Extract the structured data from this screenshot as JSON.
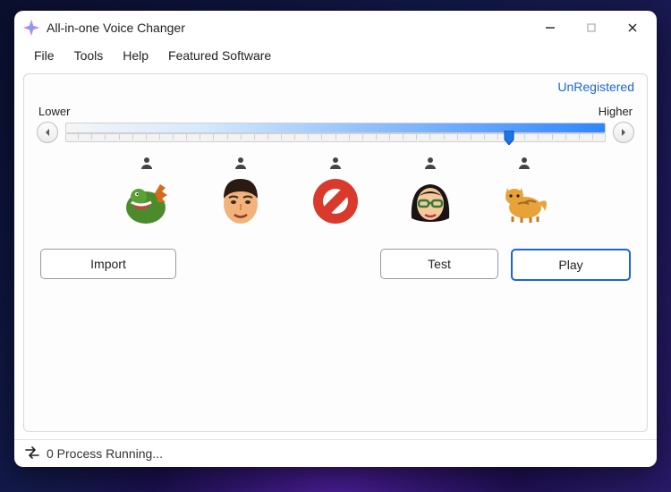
{
  "window": {
    "title": "All-in-one Voice Changer"
  },
  "menu": {
    "file": "File",
    "tools": "Tools",
    "help": "Help",
    "featured": "Featured Software"
  },
  "unregistered_label": "UnRegistered",
  "slider": {
    "lower_label": "Lower",
    "higher_label": "Higher",
    "value_percent": 82
  },
  "presets": [
    {
      "id": "dino",
      "name": "dino-preset"
    },
    {
      "id": "man",
      "name": "man-preset"
    },
    {
      "id": "block",
      "name": "block-preset"
    },
    {
      "id": "woman",
      "name": "woman-preset"
    },
    {
      "id": "cat",
      "name": "cat-preset"
    }
  ],
  "buttons": {
    "import": "Import",
    "test": "Test",
    "play": "Play"
  },
  "status": {
    "text": "0 Process Running..."
  }
}
